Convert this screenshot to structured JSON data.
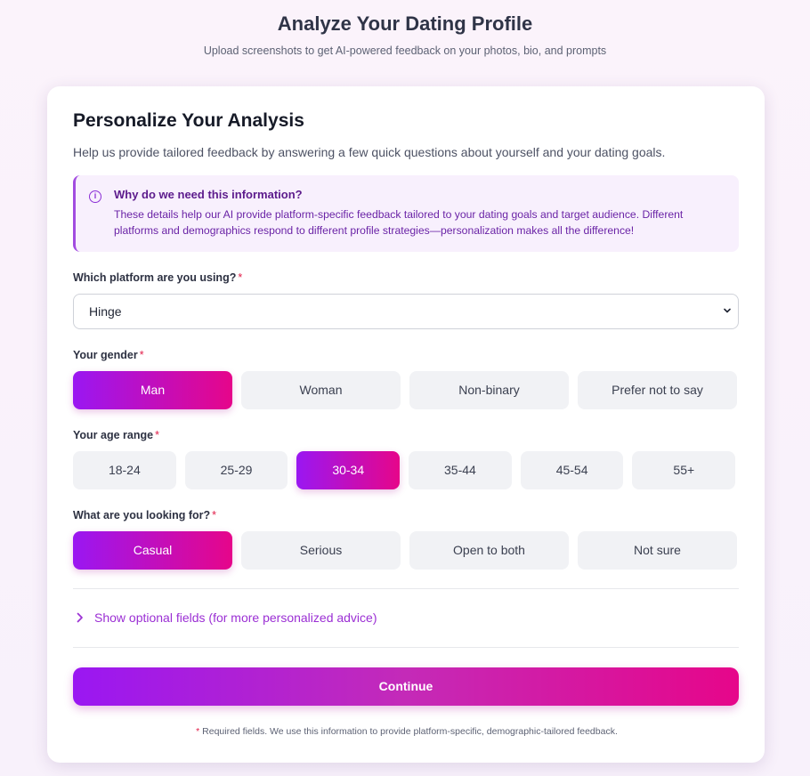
{
  "header": {
    "title": "Analyze Your Dating Profile",
    "subtitle": "Upload screenshots to get AI-powered feedback on your photos, bio, and prompts"
  },
  "card": {
    "title": "Personalize Your Analysis",
    "description": "Help us provide tailored feedback by answering a few quick questions about yourself and your dating goals.",
    "info": {
      "icon": "info-icon",
      "heading": "Why do we need this information?",
      "text": "These details help our AI provide platform-specific feedback tailored to your dating goals and target audience. Different platforms and demographics respond to different profile strategies—personalization makes all the difference!"
    },
    "platform": {
      "label": "Which platform are you using?",
      "required_mark": "*",
      "value": "Hinge"
    },
    "gender": {
      "label": "Your gender",
      "required_mark": "*",
      "options": [
        "Man",
        "Woman",
        "Non-binary",
        "Prefer not to say"
      ],
      "selected": "Man"
    },
    "age": {
      "label": "Your age range",
      "required_mark": "*",
      "options": [
        "18-24",
        "25-29",
        "30-34",
        "35-44",
        "45-54",
        "55+"
      ],
      "selected": "30-34"
    },
    "looking_for": {
      "label": "What are you looking for?",
      "required_mark": "*",
      "options": [
        "Casual",
        "Serious",
        "Open to both",
        "Not sure"
      ],
      "selected": "Casual"
    },
    "optional_toggle": "Show optional fields (for more personalized advice)",
    "continue_label": "Continue",
    "footnote_mark": "*",
    "footnote": "Required fields. We use this information to provide platform-specific, demographic-tailored feedback."
  },
  "colors": {
    "accent_start": "#9a17f2",
    "accent_end": "#e6068a",
    "required": "#e11d48"
  }
}
